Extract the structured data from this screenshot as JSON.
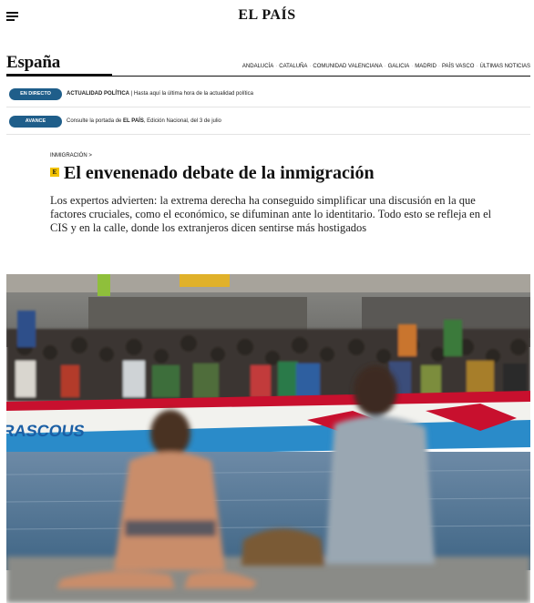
{
  "header": {
    "logo": "EL PAÍS",
    "menu_icon": "hamburger-menu-icon"
  },
  "section": {
    "title": "España",
    "subnav": [
      "ANDALUCÍA",
      "CATALUÑA",
      "COMUNIDAD VALENCIANA",
      "GALICIA",
      "MADRID",
      "PAÍS VASCO",
      "ÚLTIMAS NOTICIAS"
    ]
  },
  "ribbons": [
    {
      "pill": "EN DIRECTO",
      "bold": "ACTUALIDAD POLÍTICA",
      "text": " | Hasta aquí la última hora de la actualidad política"
    },
    {
      "pill": "AVANCE",
      "text_before": "Consulte la portada de ",
      "bold": "EL PAÍS",
      "text_after": ", Edición Nacional, del 3 de julio"
    }
  ],
  "article": {
    "kicker": "INMIGRACIÓN >",
    "badge": "E",
    "headline": "El envenenado debate de la inmigración",
    "subtitle": "Los expertos advierten: la extrema derecha ha conseguido simplificar una discusión en la que factores cruciales, como el económico, se difuminan ante lo identitario. Todo esto se refleja en el CIS y en la calle, donde los extranjeros dicen sentirse más hostigados"
  },
  "photo": {
    "boat_text": "RASCOUS",
    "colors": {
      "pill": "#1f5e8a",
      "badge": "#f2c200",
      "water": "#5b7fa0",
      "boat_red": "#c8102e"
    }
  }
}
